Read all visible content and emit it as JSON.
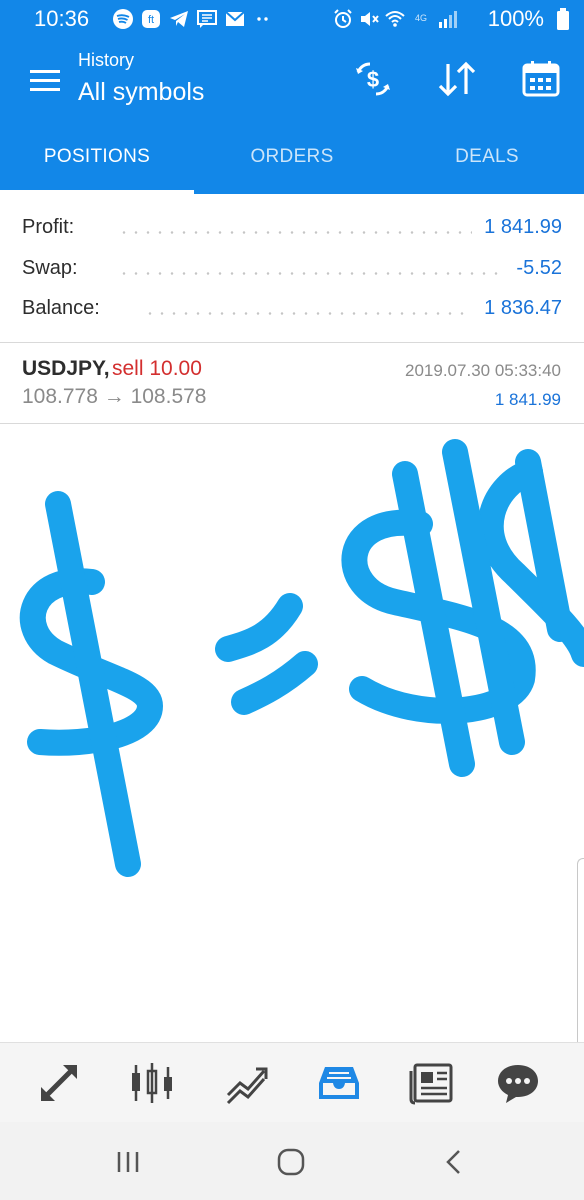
{
  "status_bar": {
    "time": "10:36",
    "battery_text": "100%",
    "left_icons": [
      "spotify-icon",
      "news-icon",
      "telegram-icon",
      "messages-icon",
      "gmail-icon",
      "more-dots-icon"
    ],
    "right_icons": [
      "alarm-icon",
      "mute-icon",
      "wifi-icon",
      "lte-icon",
      "signal-icon",
      "battery-icon"
    ]
  },
  "app_bar": {
    "subtitle": "History",
    "title": "All symbols",
    "actions": [
      "currency-exchange-icon",
      "sort-icon",
      "calendar-icon"
    ]
  },
  "tabs": [
    {
      "label": "POSITIONS",
      "active": true
    },
    {
      "label": "ORDERS",
      "active": false
    },
    {
      "label": "DEALS",
      "active": false
    }
  ],
  "summary": {
    "profit_label": "Profit:",
    "profit_value": "1 841.99",
    "swap_label": "Swap:",
    "swap_value": "-5.52",
    "balance_label": "Balance:",
    "balance_value": "1 836.47"
  },
  "deal": {
    "symbol": "USDJPY,",
    "side": "sell 10.00",
    "prices": "108.778 → 108.578",
    "datetime": "2019.07.30 05:33:40",
    "profit": "1 841.99"
  },
  "bottom_nav": [
    {
      "icon": "trade-icon",
      "active": false
    },
    {
      "icon": "candlestick-chart-icon",
      "active": false
    },
    {
      "icon": "trend-chart-icon",
      "active": false
    },
    {
      "icon": "history-inbox-icon",
      "active": true
    },
    {
      "icon": "news-icon",
      "active": false
    },
    {
      "icon": "chat-icon",
      "active": false
    }
  ],
  "colors": {
    "primary": "#1287e8",
    "value_blue": "#1a73d9",
    "sell_red": "#d32f2f",
    "doodle_blue": "#1aa3ec",
    "active_nav": "#1e88e5",
    "nav_icon": "#444444"
  }
}
